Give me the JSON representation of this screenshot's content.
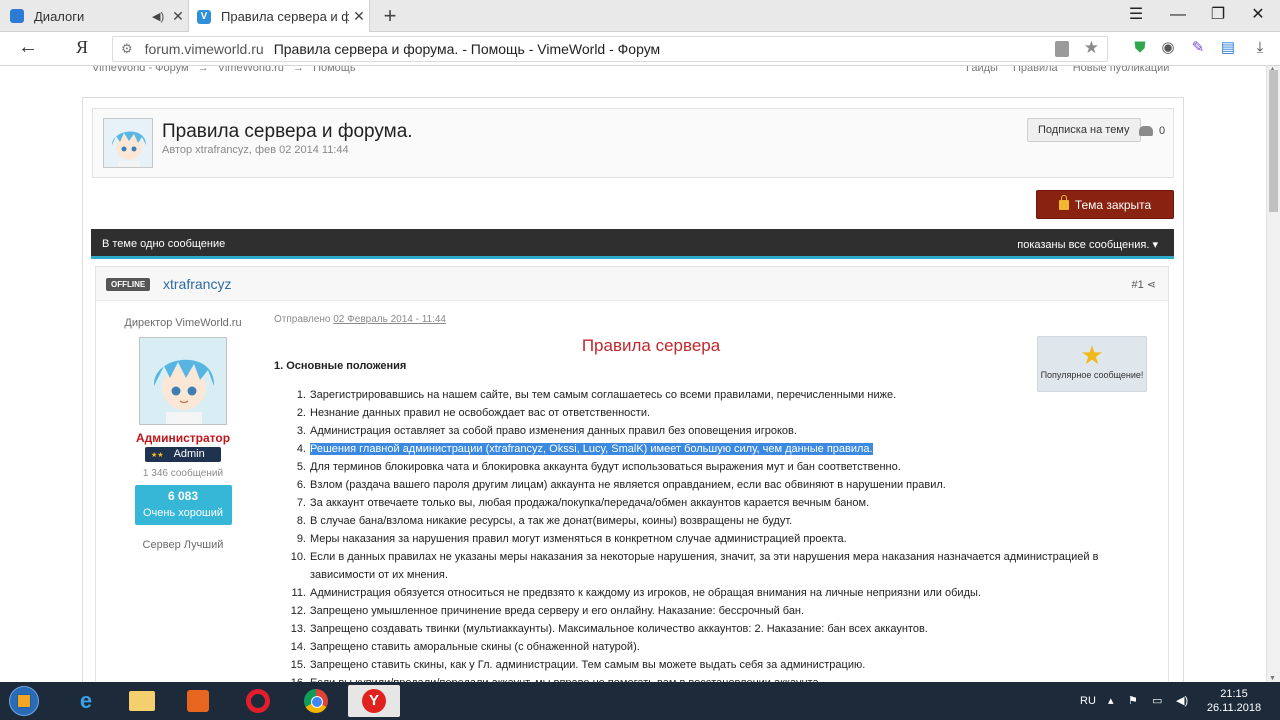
{
  "browser": {
    "tabs": [
      {
        "label": "Диалоги",
        "active": false
      },
      {
        "label": "Правила сервера и форум",
        "active": true
      }
    ],
    "url_domain": "forum.vimeworld.ru",
    "url_title": "Правила сервера и форума. - Помощь - VimeWorld - Форум",
    "yandex_glyph": "Я"
  },
  "breadcrumbs": [
    "VimeWorld - Форум",
    "→",
    "VimeWorld.ru",
    "→",
    "Помощь"
  ],
  "top_links": [
    "Гайды",
    "Правила",
    "Новые публикации"
  ],
  "topic": {
    "title": "Правила сервера и форума.",
    "byline": "Автор xtrafrancyz, фев 02 2014 11:44",
    "subscribe_label": "Подписка на тему",
    "followers_count": "0",
    "closed_label": "Тема закрыта"
  },
  "thread_bar": {
    "left": "В теме одно сообщение",
    "right": "показаны все сообщения."
  },
  "post": {
    "status_badge": "OFFLINE",
    "author": "xtrafrancyz",
    "post_number": "#1",
    "user_title": "Директор VimeWorld.ru",
    "group_name": "Администратор",
    "badge_label": "Admin",
    "badge_stars": "★★",
    "message_count": "1 346 сообщений",
    "reputation_value": "6 083",
    "reputation_label": "Очень хороший",
    "server_label": "Сервер Лучший",
    "sent_prefix": "Отправлено",
    "sent_date": "02 Февраль 2014 - 11:44",
    "popular_label": "Популярное сообщение!",
    "rules_title": "Правила сервера",
    "section_title": "1. Основные положения",
    "rules": [
      {
        "num": "1.",
        "text": "Зарегистрировавшись на нашем сайте, вы тем самым соглашаетесь со всеми правилами, перечисленными ниже."
      },
      {
        "num": "2.",
        "text": "Незнание данных правил не освобождает вас от ответственности."
      },
      {
        "num": "3.",
        "text": "Администрация оставляет за собой право изменения данных правил без оповещения игроков."
      },
      {
        "num": "4.",
        "text": "Решения главной администрации (xtrafrancyz, Okssi, Lucy, SmalK) имеет большую силу, чем данные правила.",
        "highlighted": true
      },
      {
        "num": "5.",
        "text": "Для терминов блокировка чата и блокировка аккаунта будут использоваться выражения мут и бан соответственно."
      },
      {
        "num": "6.",
        "text": "Взлом (раздача вашего пароля другим лицам) аккаунта не является оправданием, если вас обвиняют в нарушении правил."
      },
      {
        "num": "7.",
        "text": "За аккаунт отвечаете только вы, любая продажа/покупка/передача/обмен аккаунтов карается вечным баном."
      },
      {
        "num": "8.",
        "text": "В случае бана/взлома никакие ресурсы, а так же донат(вимеры, коины) возвращены не будут."
      },
      {
        "num": "9.",
        "text": "Меры наказания за нарушения правил могут изменяться в конкретном случае администрацией проекта."
      },
      {
        "num": "10.",
        "text": "Если в данных правилах не указаны меры наказания за некоторые нарушения, значит, за эти нарушения мера наказания назначается администрацией в зависимости от их мнения."
      },
      {
        "num": "11.",
        "text": "Администрация обязуется относиться не предвзято к каждому из игроков, не обращая внимания на личные неприязни или обиды."
      },
      {
        "num": "12.",
        "text": "Запрещено умышленное причинение вреда серверу и его онлайну. Наказание: бессрочный бан."
      },
      {
        "num": "13.",
        "text": "Запрещено создавать твинки (мультиаккаунты). Максимальное количество аккаунтов: 2. Наказание: бан всех аккаунтов."
      },
      {
        "num": "14.",
        "text": "Запрещено ставить аморальные скины (с обнаженной натурой)."
      },
      {
        "num": "15.",
        "text": "Запрещено ставить скины, как у Гл. администрации. Тем самым вы можете выдать себя за администрацию."
      },
      {
        "num": "16.",
        "text": "Если вы купили/продали/передали аккаунт, мы вправе не помогать вам в восстановлении аккаунта."
      }
    ]
  },
  "taskbar": {
    "language": "RU",
    "time": "21:15",
    "date": "26.11.2018"
  },
  "colors": {
    "accent_link": "#2b6aa8",
    "closed_button": "#8a2211",
    "rules_title": "#c1272d",
    "reputation": "#37b7d7",
    "highlight": "#3b89e0"
  }
}
